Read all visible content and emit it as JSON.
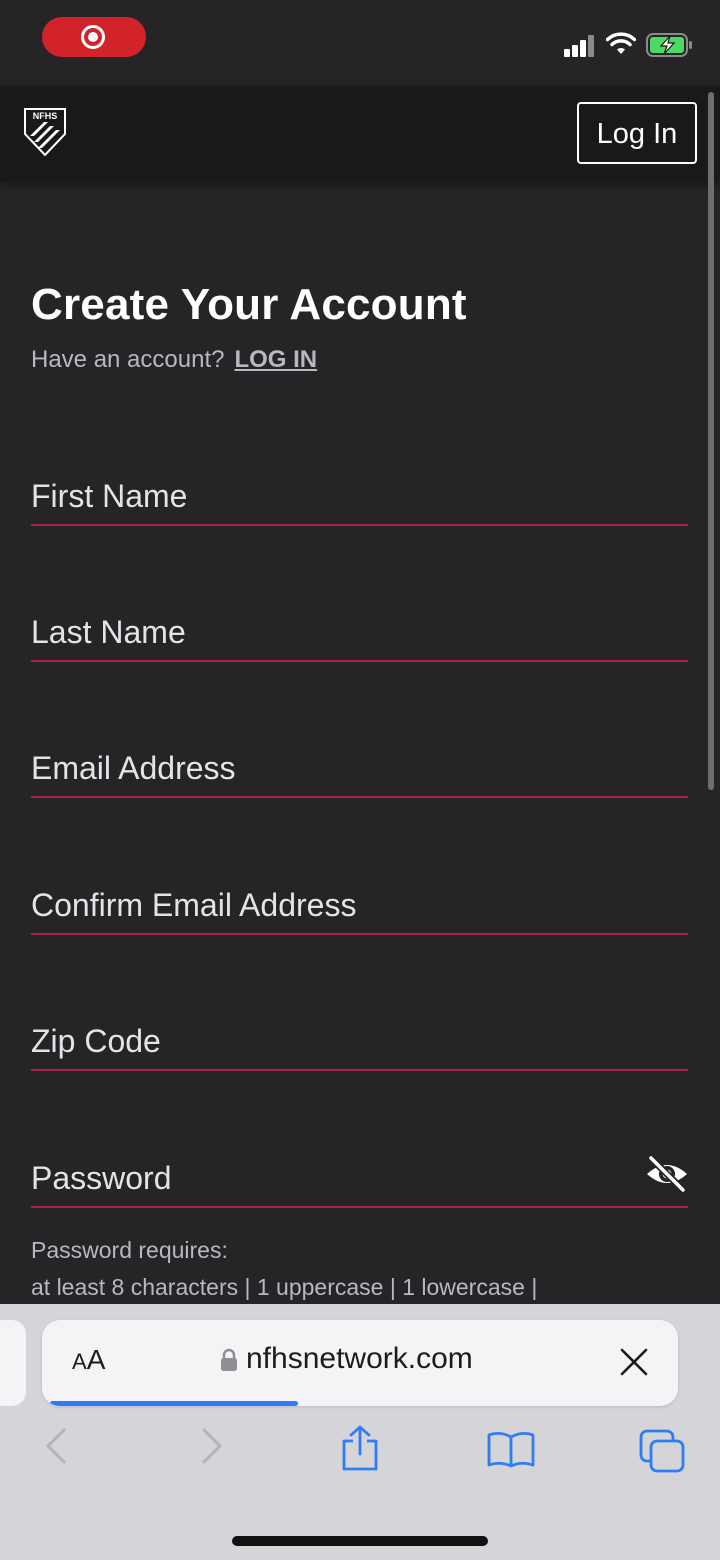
{
  "header": {
    "login_label": "Log In"
  },
  "form": {
    "title": "Create Your Account",
    "have_account": "Have an account?",
    "login_link": "LOG IN",
    "fields": {
      "first_name": "First Name",
      "last_name": "Last Name",
      "email": "Email Address",
      "confirm_email": "Confirm Email Address",
      "zip": "Zip Code",
      "password": "Password"
    },
    "password_requires": "Password requires:",
    "password_rules": "at least 8 characters |  1 uppercase |  1 lowercase |"
  },
  "browser": {
    "text_size_label_small": "A",
    "text_size_label_large": "A",
    "url": "nfhsnetwork.com",
    "load_progress": 0.4
  },
  "icons": {
    "logo": "nfhs-network-logo",
    "password_toggle": "eye-slash-icon",
    "lock": "lock-icon",
    "close": "close-icon",
    "back": "chevron-left-icon",
    "forward": "chevron-right-icon",
    "share": "share-icon",
    "bookmarks": "book-icon",
    "tabs": "tabs-icon"
  },
  "colors": {
    "background": "#252427",
    "header": "#19181a",
    "field_underline": "#a8214a",
    "record_pill": "#d2232a",
    "accent_blue": "#2f7df6",
    "battery_fill": "#4cd964"
  }
}
